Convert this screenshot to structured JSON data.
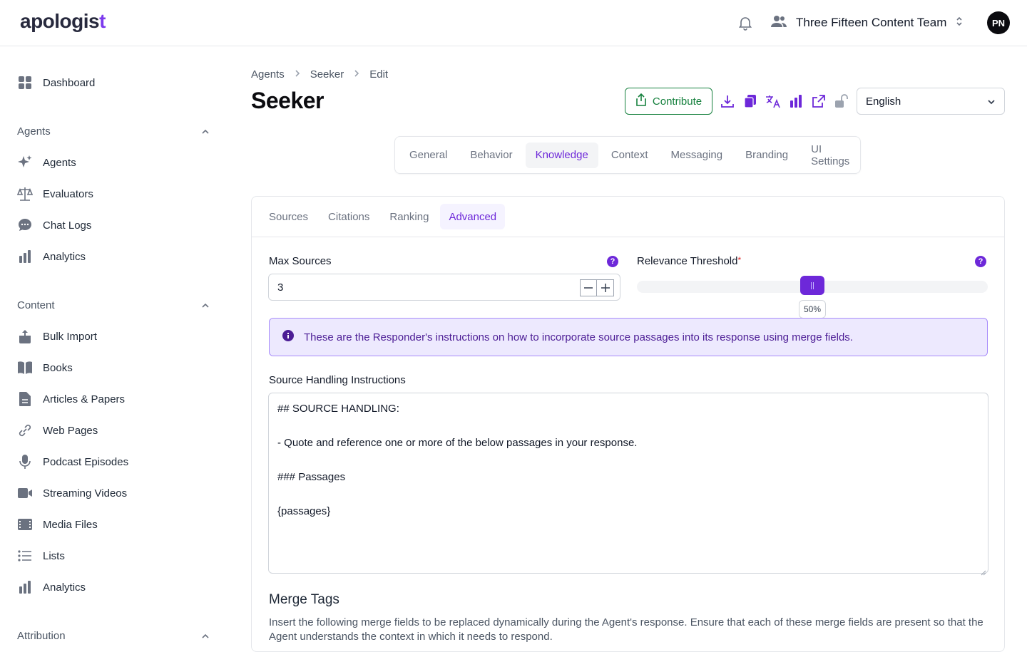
{
  "header": {
    "logo_text": "apologis",
    "logo_mark": "t",
    "team_name": "Three Fifteen Content Team",
    "avatar_initials": "PN"
  },
  "sidebar": {
    "dashboard": "Dashboard",
    "sections": {
      "agents": "Agents",
      "content": "Content",
      "attribution": "Attribution"
    },
    "agent_items": [
      "Agents",
      "Evaluators",
      "Chat Logs",
      "Analytics"
    ],
    "content_items": [
      "Bulk Import",
      "Books",
      "Articles & Papers",
      "Web Pages",
      "Podcast Episodes",
      "Streaming Videos",
      "Media Files",
      "Lists",
      "Analytics"
    ]
  },
  "breadcrumb": [
    "Agents",
    "Seeker",
    "Edit"
  ],
  "page": {
    "title": "Seeker",
    "contribute_label": "Contribute",
    "language": "English"
  },
  "tabs": [
    "General",
    "Behavior",
    "Knowledge",
    "Context",
    "Messaging",
    "Branding",
    "UI Settings"
  ],
  "active_tab": "Knowledge",
  "subtabs": [
    "Sources",
    "Citations",
    "Ranking",
    "Advanced"
  ],
  "active_subtab": "Advanced",
  "fields": {
    "max_sources_label": "Max Sources",
    "max_sources_value": "3",
    "relevance_label": "Relevance Threshold",
    "required_mark": "*",
    "relevance_value": 0.5,
    "relevance_display": "50%",
    "help_glyph": "?"
  },
  "info_message": "These are the Responder's instructions on how to incorporate source passages into its response using merge fields.",
  "instructions": {
    "label": "Source Handling Instructions",
    "lines": [
      "## SOURCE HANDLING:",
      "",
      "- Quote and reference one or more of the below passages in your response.",
      "",
      "### Passages",
      "",
      "{passages}"
    ]
  },
  "merge": {
    "title": "Merge Tags",
    "description": "Insert the following merge fields to be replaced dynamically during the Agent's response. Ensure that each of these merge fields are present so that the Agent understands the context in which it needs to respond."
  },
  "colors": {
    "accent": "#6d28d9",
    "success": "#15803d",
    "info_bg": "#ede9fe"
  }
}
